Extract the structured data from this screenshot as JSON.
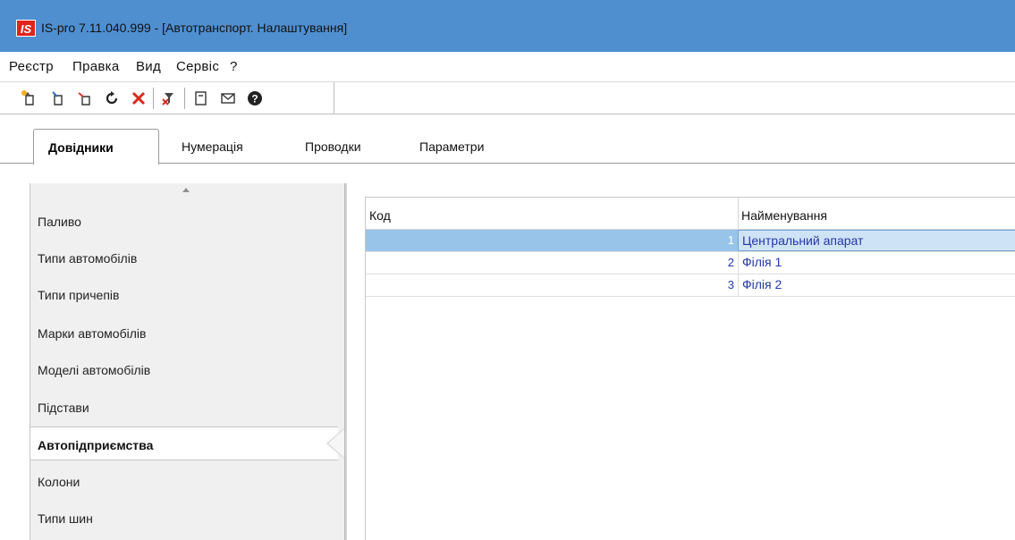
{
  "window": {
    "logo_text": "IS",
    "title": "IS-pro 7.11.040.999 - [Автотранспорт. Налаштування]"
  },
  "menu": [
    "Реєстр",
    "Правка",
    "Вид",
    "Сервіс",
    "?"
  ],
  "toolbar": {
    "icons": [
      "new-icon",
      "edit-icon",
      "copy-icon",
      "refresh-icon",
      "delete-icon",
      "clear-filter-icon",
      "document-icon",
      "envelope-icon",
      "help-icon"
    ]
  },
  "tabs": [
    "Довідники",
    "Нумерація",
    "Проводки",
    "Параметри"
  ],
  "active_tab": "Довідники",
  "sidebar": {
    "items": [
      "Паливо",
      "Типи автомобілів",
      "Типи причепів",
      "Марки автомобілів",
      "Моделі автомобілів",
      "Підстави",
      "Автопідприємства",
      "Колони",
      "Типи шин"
    ],
    "active": "Автопідприємства"
  },
  "grid": {
    "columns": [
      "Код",
      "Найменування"
    ],
    "rows": [
      {
        "code": "1",
        "name": "Центральний апарат"
      },
      {
        "code": "2",
        "name": "Філія 1"
      },
      {
        "code": "3",
        "name": "Філія 2"
      }
    ],
    "selected_index": 0
  },
  "colors": {
    "titlebar": "#4f8fd0",
    "selection": "#99c4ea",
    "text_link": "#2437a6",
    "logo": "#e0241b"
  }
}
